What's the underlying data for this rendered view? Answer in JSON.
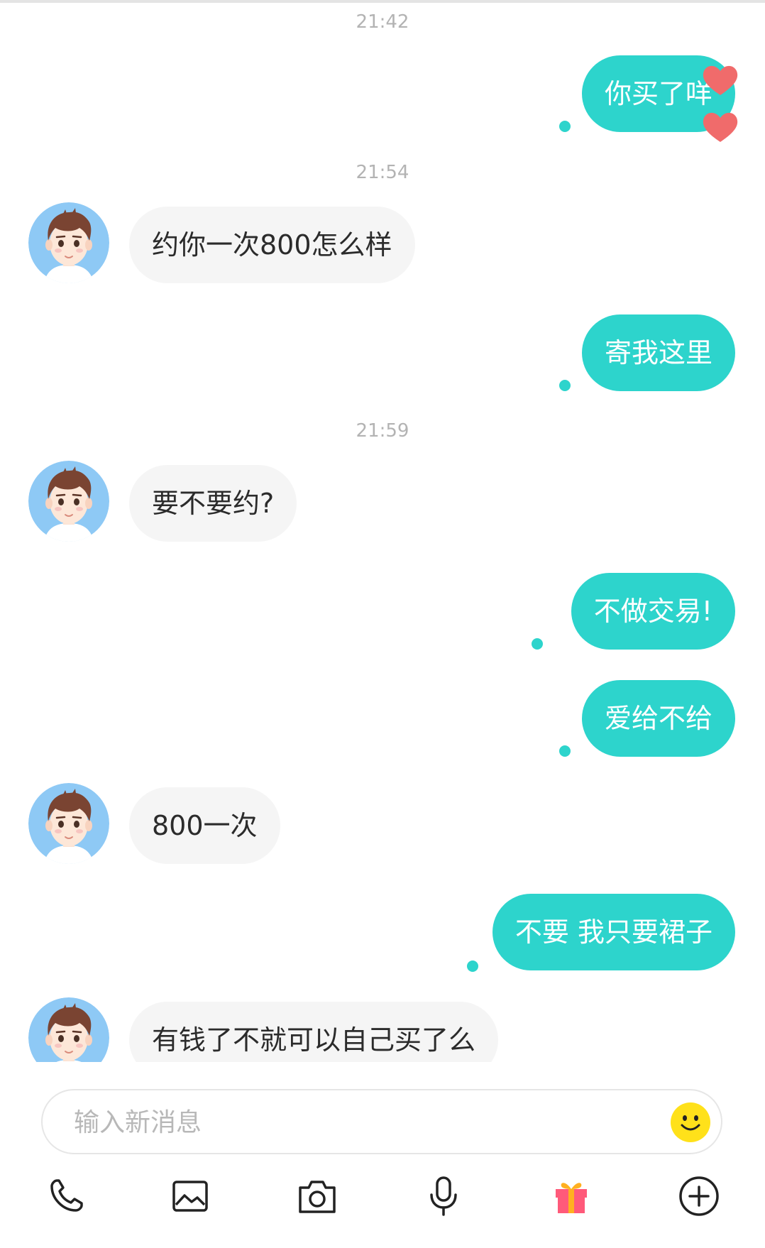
{
  "messages": {
    "ts1": "21:42",
    "out1": "你买了咩",
    "ts2": "21:54",
    "in1": "约你一次800怎么样",
    "out2": "寄我这里",
    "ts3": "21:59",
    "in2": "要不要约?",
    "out3": "不做交易!",
    "out4": "爱给不给",
    "in3": "800一次",
    "out5": "不要 我只要裙子",
    "in4": "有钱了不就可以自己买了么"
  },
  "input": {
    "placeholder": "输入新消息"
  },
  "toolbar": {
    "icons": [
      "phone-icon",
      "image-icon",
      "camera-icon",
      "microphone-icon",
      "gift-icon",
      "plus-circle-icon"
    ]
  },
  "colors": {
    "outgoing_bubble": "#2dd4cc",
    "incoming_bubble": "#f5f5f5",
    "timestamp": "#b3b3b3",
    "heart": "#f06b6b",
    "avatar_bg": "#8ec9f5"
  }
}
